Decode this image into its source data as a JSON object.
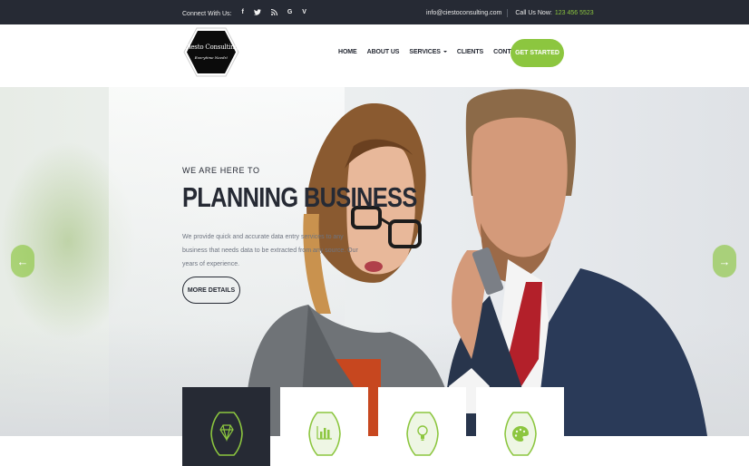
{
  "topbar": {
    "connect_label": "Connect With Us:",
    "social": [
      {
        "icon": "facebook-icon",
        "glyph": "f"
      },
      {
        "icon": "twitter-icon",
        "glyph": "ᵛ"
      },
      {
        "icon": "rss-icon",
        "glyph": "≡"
      },
      {
        "icon": "google-icon",
        "glyph": "G"
      },
      {
        "icon": "vimeo-icon",
        "glyph": "V"
      }
    ],
    "email": "info@ciestoconsulting.com",
    "call_label": "Call Us Now:",
    "phone": "123 456 5523"
  },
  "header": {
    "logo_name": "Ciesto Consulting",
    "logo_tagline": "Everytime Needs!",
    "nav": [
      "HOME",
      "ABOUT US",
      "SERVICES",
      "CLIENTS",
      "CONTACT US!"
    ],
    "cta": "GET STARTED"
  },
  "hero": {
    "subhead": "WE ARE HERE TO",
    "headline": "PLANNING BUSINESS",
    "description": "We provide quick and accurate data entry services to any business that needs data to be extracted from any source. Our years of experience.",
    "button": "MORE DETAILS",
    "prev_arrow": "←",
    "next_arrow": "→"
  },
  "features": [
    {
      "icon": "diamond-icon",
      "active": true
    },
    {
      "icon": "bar-chart-icon",
      "active": false
    },
    {
      "icon": "lightbulb-icon",
      "active": false
    },
    {
      "icon": "palette-icon",
      "active": false
    }
  ],
  "colors": {
    "accent": "#8cc63f",
    "dark": "#262a34"
  }
}
